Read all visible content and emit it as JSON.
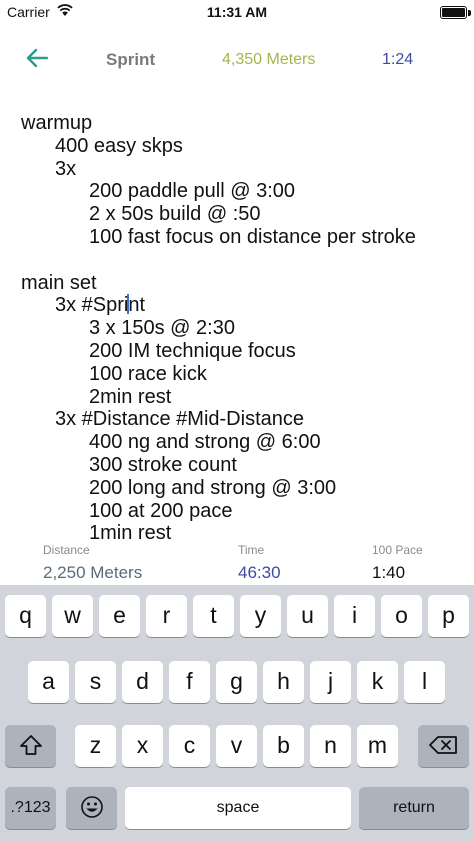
{
  "status_bar": {
    "carrier": "Carrier",
    "time": "11:31 AM",
    "battery_icon": "battery-full-icon",
    "wifi_icon": "wifi-icon"
  },
  "header": {
    "back_icon": "arrow-left-icon",
    "title": "Sprint",
    "total_meters": "4,350 Meters",
    "pace": "1:24",
    "colors": {
      "back_arrow": "#2a9d8f",
      "meters": "#a9b34b",
      "pace": "#3d4aa8"
    }
  },
  "editor": {
    "lines": [
      {
        "indent": 0,
        "text": "warmup"
      },
      {
        "indent": 1,
        "text": "400 easy skps"
      },
      {
        "indent": 1,
        "text": "3x"
      },
      {
        "indent": 2,
        "text": "200 paddle pull @ 3:00"
      },
      {
        "indent": 2,
        "text": "2 x 50s build @ :50"
      },
      {
        "indent": 2,
        "text": "100 fast focus on distance per stroke"
      },
      {
        "indent": 0,
        "text": ""
      },
      {
        "indent": 0,
        "text": "main set"
      },
      {
        "indent": 1,
        "text_before_cursor": "3x #Spri",
        "text_after_cursor": "nt"
      },
      {
        "indent": 2,
        "text": "3 x 150s @ 2:30"
      },
      {
        "indent": 2,
        "text": "200 IM technique focus"
      },
      {
        "indent": 2,
        "text": "100 race kick"
      },
      {
        "indent": 2,
        "text": "2min rest"
      },
      {
        "indent": 1,
        "text": "3x #Distance #Mid-Distance"
      },
      {
        "indent": 2,
        "text": "400 ng and strong @ 6:00"
      },
      {
        "indent": 2,
        "text": "300 stroke count"
      },
      {
        "indent": 2,
        "text": "200 long and strong @ 3:00"
      },
      {
        "indent": 2,
        "text": "100 at 200 pace"
      },
      {
        "indent": 2,
        "text": "1min rest"
      }
    ]
  },
  "summary": {
    "distance_label": "Distance",
    "distance_value": "2,250 Meters",
    "time_label": "Time",
    "time_value": "46:30",
    "pace_label": "100 Pace",
    "pace_value": "1:40"
  },
  "keyboard": {
    "row1": [
      "q",
      "w",
      "e",
      "r",
      "t",
      "y",
      "u",
      "i",
      "o",
      "p"
    ],
    "row2": [
      "a",
      "s",
      "d",
      "f",
      "g",
      "h",
      "j",
      "k",
      "l"
    ],
    "row3": [
      "z",
      "x",
      "c",
      "v",
      "b",
      "n",
      "m"
    ],
    "shift_icon": "shift-icon",
    "delete_icon": "backspace-icon",
    "numbers_label": ".?123",
    "emoji_icon": "emoji-icon",
    "space_label": "space",
    "return_label": "return"
  }
}
